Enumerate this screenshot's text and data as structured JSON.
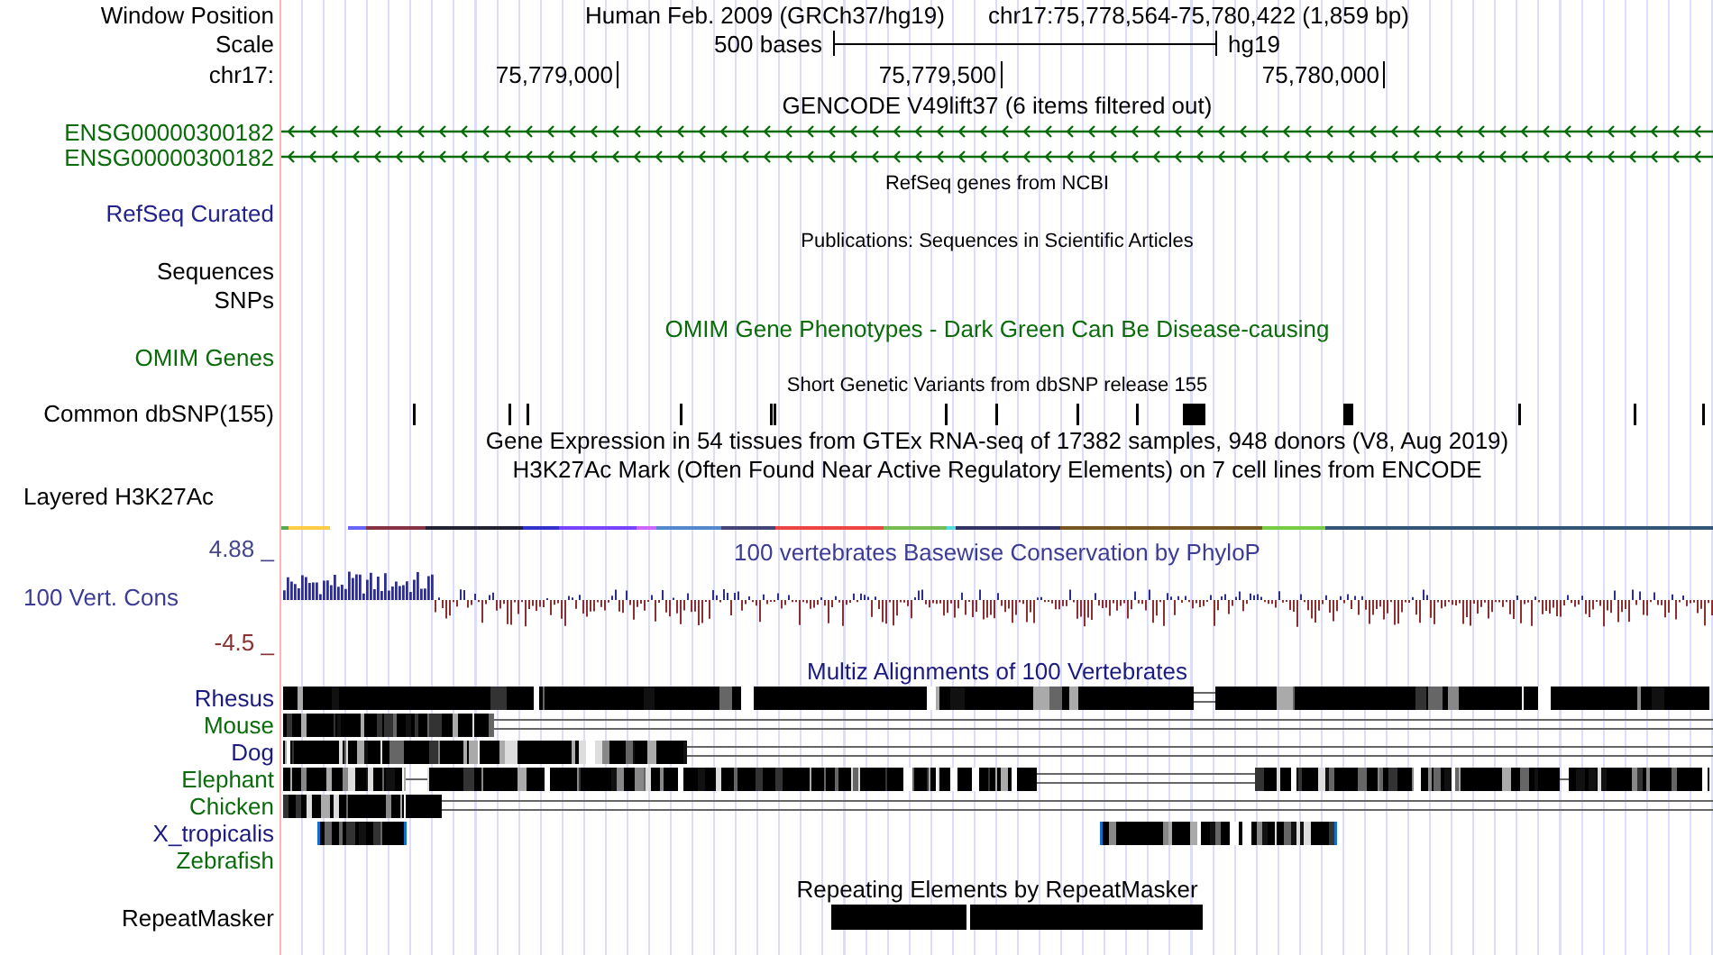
{
  "header": {
    "label": "Window Position",
    "title": "Human Feb. 2009 (GRCh37/hg19)",
    "position": "chr17:75,778,564-75,780,422 (1,859 bp)"
  },
  "scale": {
    "label": "Scale",
    "length": "500 bases",
    "assembly": "hg19"
  },
  "ruler": {
    "label": "chr17:",
    "ticks": [
      "75,779,000",
      "75,779,500",
      "75,780,000"
    ]
  },
  "tracks": [
    {
      "kind": "title",
      "text": "GENCODE V49lift37 (6 items filtered out)",
      "color": "#000000"
    },
    {
      "kind": "gene",
      "label": "ENSG00000300182",
      "color": "#0a6b0a"
    },
    {
      "kind": "gene",
      "label": "ENSG00000300182",
      "color": "#0a6b0a"
    },
    {
      "kind": "caption",
      "text": "RefSeq genes from NCBI"
    },
    {
      "kind": "label",
      "label": "RefSeq Curated",
      "color": "#22228c"
    },
    {
      "kind": "caption",
      "text": "Publications: Sequences in Scientific Articles"
    },
    {
      "kind": "label",
      "label": "Sequences",
      "color": "#000000"
    },
    {
      "kind": "label",
      "label": "SNPs",
      "color": "#000000"
    },
    {
      "kind": "title",
      "text": "OMIM Gene Phenotypes - Dark Green Can Be Disease-causing",
      "color": "#0a6b0a"
    },
    {
      "kind": "label",
      "label": "OMIM Genes",
      "color": "#0a6b0a"
    },
    {
      "kind": "caption",
      "text": "Short Genetic Variants from dbSNP release 155"
    },
    {
      "kind": "snps",
      "label": "Common dbSNP(155)",
      "color": "#000000"
    },
    {
      "kind": "title",
      "text": "Gene Expression in 54 tissues from GTEx RNA-seq of 17382 samples, 948 donors (V8, Aug 2019)",
      "color": "#000000"
    },
    {
      "kind": "title",
      "text": "H3K27Ac Mark (Often Found Near Active Regulatory Elements) on 7 cell lines from ENCODE",
      "color": "#000000"
    },
    {
      "kind": "layered",
      "label": "Layered H3K27Ac",
      "color": "#000000"
    },
    {
      "kind": "wiggle",
      "label": "100 Vert. Cons",
      "color": "#3c3c96",
      "max": "4.88 _",
      "min": "-4.5 _",
      "title": "100 vertebrates Basewise Conservation by PhyloP"
    },
    {
      "kind": "title",
      "text": "Multiz Alignments of 100 Vertebrates",
      "color": "#1a1a80"
    },
    {
      "kind": "alignment",
      "label": "Rhesus",
      "color": "#1a1a80"
    },
    {
      "kind": "alignment",
      "label": "Mouse",
      "color": "#0a6b0a"
    },
    {
      "kind": "alignment",
      "label": "Dog",
      "color": "#1a1a80"
    },
    {
      "kind": "alignment",
      "label": "Elephant",
      "color": "#0a6b0a"
    },
    {
      "kind": "alignment",
      "label": "Chicken",
      "color": "#0a6b0a"
    },
    {
      "kind": "alignment",
      "label": "X_tropicalis",
      "color": "#1a1a80"
    },
    {
      "kind": "alignment",
      "label": "Zebrafish",
      "color": "#0a6b0a"
    },
    {
      "kind": "title",
      "text": "Repeating Elements by RepeatMasker",
      "color": "#000000"
    },
    {
      "kind": "repeats",
      "label": "RepeatMasker",
      "color": "#000000"
    }
  ]
}
